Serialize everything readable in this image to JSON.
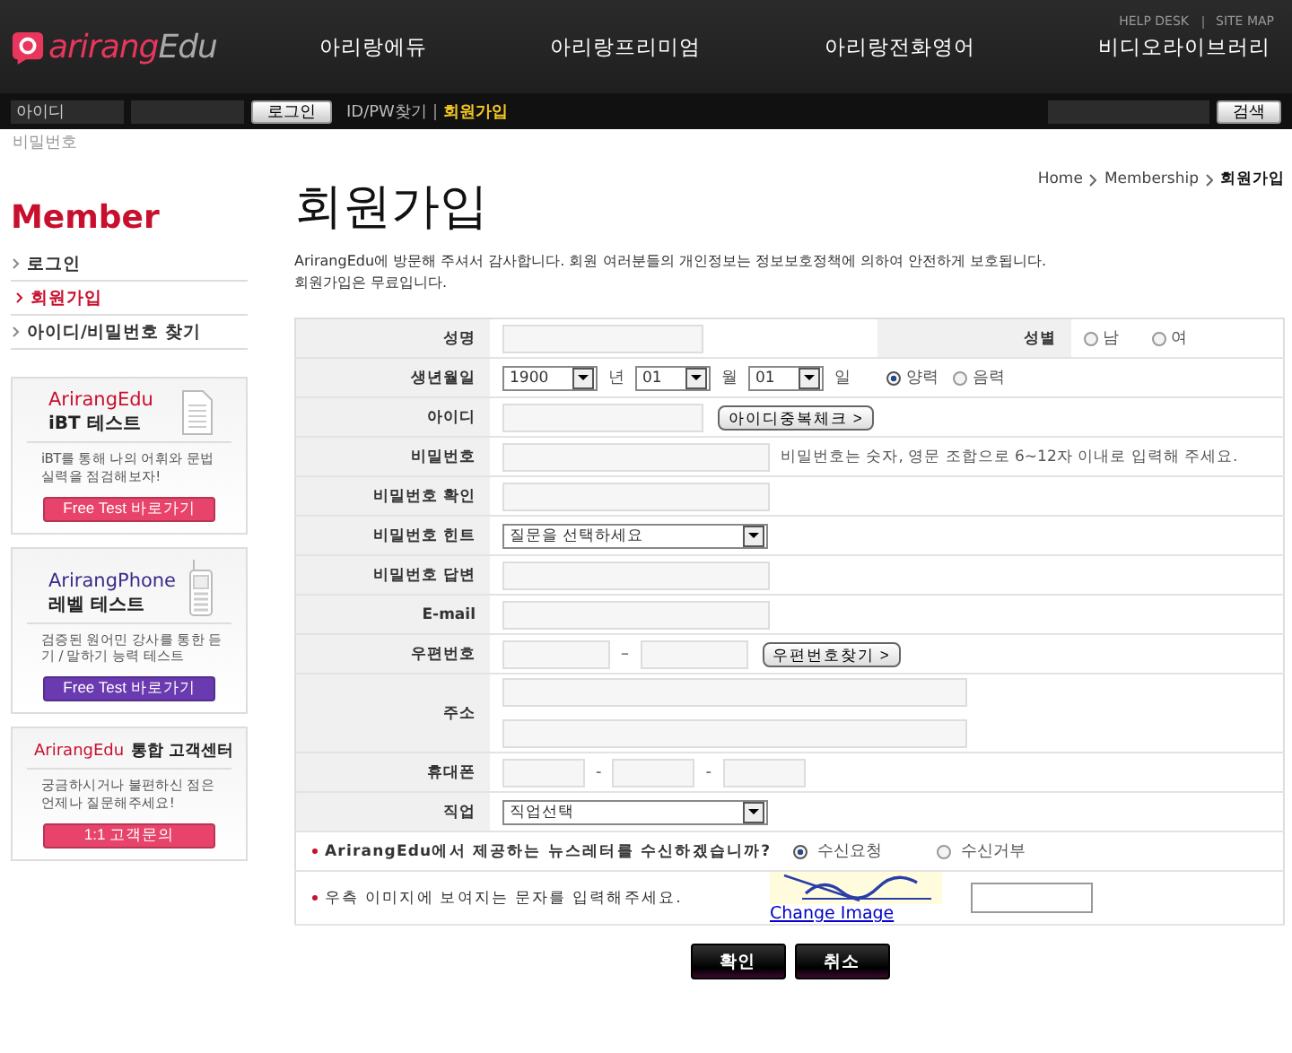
{
  "header": {
    "logo": {
      "brand": "arirang",
      "suffix": "Edu"
    },
    "top_links": [
      "HELP DESK",
      "SITE MAP"
    ],
    "nav": [
      "아리랑에듀",
      "아리랑프리미엄",
      "아리랑전화영어",
      "비디오라이브러리"
    ],
    "login": {
      "id_placeholder": "아이디",
      "password_label": "비밀번호",
      "button": "로그인",
      "links": [
        {
          "label": "ID/PW찾기",
          "selected": false
        },
        {
          "label": "회원가입",
          "selected": true
        }
      ],
      "search_button": "검색"
    }
  },
  "sidebar": {
    "title": "Member",
    "menu": [
      {
        "label": "로그인",
        "selected": false
      },
      {
        "label": "회원가입",
        "selected": true
      },
      {
        "label": "아이디/비밀번호 찾기",
        "selected": false
      }
    ],
    "cards": [
      {
        "kind": "document",
        "brand": "ArirangEdu",
        "title": "iBT 테스트",
        "text": "iBT를 통해 나의 어휘와 문법 실력을 점검해보자!",
        "button": "Free Test 바로가기",
        "color": "#e8436a"
      },
      {
        "kind": "phone",
        "brand": "ArirangPhone",
        "title": "레벨 테스트",
        "text": "검증된 원어민 강사를 통한 듣기 / 말하기 능력 테스트",
        "button": "Free Test 바로가기",
        "color": "#6a3ab0"
      },
      {
        "kind": "plain",
        "brand": "ArirangEdu",
        "title": "통합 고객센터",
        "text": "궁금하시거나 불편하신 점은 언제나 질문해주세요!",
        "button": "1:1 고객문의",
        "color": "#e8436a"
      }
    ]
  },
  "main": {
    "title": "회원가입",
    "breadcrumb": [
      {
        "label": "Home",
        "selected": false
      },
      {
        "label": "Membership",
        "selected": false
      },
      {
        "label": "회원가입",
        "selected": true
      }
    ],
    "intro": [
      "ArirangEdu에 방문해 주셔서 감사합니다. 회원 여러분들의 개인정보는 정보보호정책에 의하여 안전하게 보호됩니다.",
      "회원가입은 무료입니다."
    ],
    "rows": [
      {
        "kind": "name",
        "label": "성명",
        "side_label": "성별",
        "options": [
          {
            "label": "남",
            "selected": false
          },
          {
            "label": "여",
            "selected": false
          }
        ]
      },
      {
        "kind": "birth",
        "label": "생년월일",
        "selects": [
          {
            "value": "1900",
            "unit": "년"
          },
          {
            "value": "01",
            "unit": "월"
          },
          {
            "value": "01",
            "unit": "일"
          }
        ],
        "options": [
          {
            "label": "양력",
            "selected": true
          },
          {
            "label": "음력",
            "selected": false
          }
        ]
      },
      {
        "kind": "id",
        "label": "아이디",
        "button": "아이디중복체크 >"
      },
      {
        "kind": "note",
        "label": "비밀번호",
        "note": "비밀번호는 숫자, 영문 조합으로 6~12자 이내로 입력해 주세요."
      },
      {
        "kind": "input",
        "label": "비밀번호 확인"
      },
      {
        "kind": "select",
        "label": "비밀번호 힌트",
        "value": "질문을 선택하세요"
      },
      {
        "kind": "input",
        "label": "비밀번호 답변"
      },
      {
        "kind": "input",
        "label": "E-mail"
      },
      {
        "kind": "zip",
        "label": "우편번호",
        "separator": "–",
        "button": "우편번호찾기 >"
      },
      {
        "kind": "address",
        "label": "주소"
      },
      {
        "kind": "phone",
        "label": "휴대폰",
        "separators": [
          "-",
          "-"
        ]
      },
      {
        "kind": "select",
        "label": "직업",
        "value": "직업선택"
      }
    ],
    "newsletter": {
      "question": "ArirangEdu에서 제공하는 뉴스레터를 수신하겠습니까?",
      "options": [
        {
          "label": "수신요청",
          "selected": true
        },
        {
          "label": "수신거부",
          "selected": false
        }
      ]
    },
    "captcha": {
      "prompt": "우측 이미지에 보여지는 문자를 입력해주세요.",
      "link": "Change Image"
    },
    "buttons": [
      "확인",
      "취소"
    ]
  }
}
